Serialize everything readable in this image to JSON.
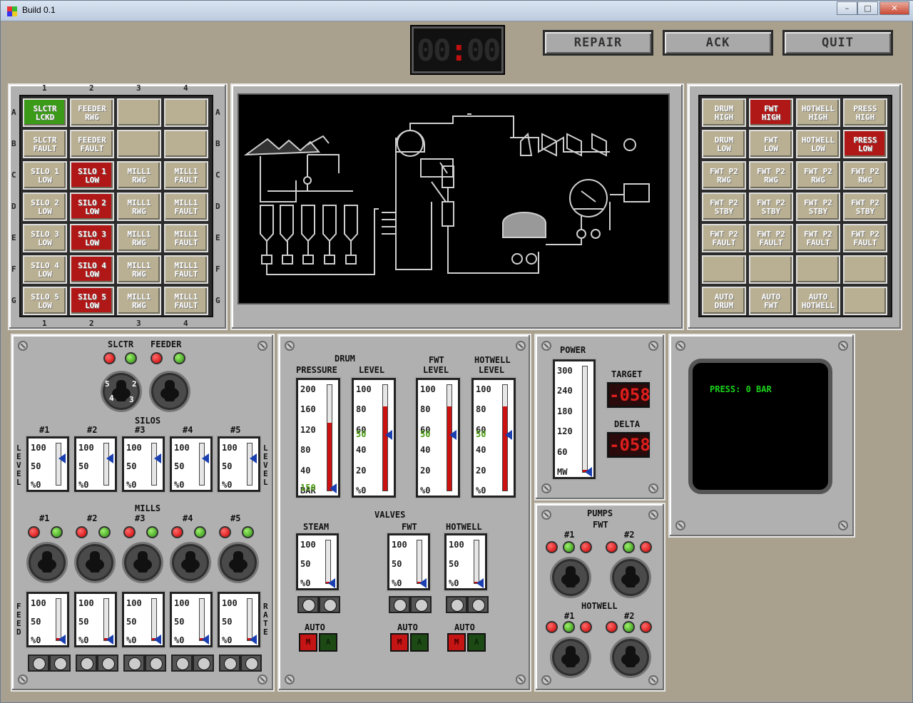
{
  "window": {
    "title": "Build 0.1",
    "minimize": "–",
    "maximize": "□",
    "close": "✕"
  },
  "toolbar": {
    "clock": [
      "00",
      ":",
      "00"
    ],
    "repair": "REPAIR",
    "ack": "ACK",
    "quit": "QUIT"
  },
  "annunciator_left": {
    "cols": [
      "1",
      "2",
      "3",
      "4"
    ],
    "rows": [
      "A",
      "B",
      "C",
      "D",
      "E",
      "F",
      "G"
    ],
    "cells": [
      [
        {
          "t": "SLCTR\nLCKD",
          "s": "green"
        },
        {
          "t": "FEEDER\nRWG",
          "s": "off"
        },
        {
          "t": "",
          "s": "off"
        },
        {
          "t": "",
          "s": "off"
        }
      ],
      [
        {
          "t": "SLCTR\nFAULT",
          "s": "off"
        },
        {
          "t": "FEEDER\nFAULT",
          "s": "off"
        },
        {
          "t": "",
          "s": "off"
        },
        {
          "t": "",
          "s": "off"
        }
      ],
      [
        {
          "t": "SILO 1\nLOW",
          "s": "off"
        },
        {
          "t": "SILO 1\nLOW",
          "s": "red"
        },
        {
          "t": "MILL1\nRWG",
          "s": "off"
        },
        {
          "t": "MILL1\nFAULT",
          "s": "off"
        }
      ],
      [
        {
          "t": "SILO 2\nLOW",
          "s": "off"
        },
        {
          "t": "SILO 2\nLOW",
          "s": "red"
        },
        {
          "t": "MILL1\nRWG",
          "s": "off"
        },
        {
          "t": "MILL1\nFAULT",
          "s": "off"
        }
      ],
      [
        {
          "t": "SILO 3\nLOW",
          "s": "off"
        },
        {
          "t": "SILO 3\nLOW",
          "s": "red"
        },
        {
          "t": "MILL1\nRWG",
          "s": "off"
        },
        {
          "t": "MILL1\nFAULT",
          "s": "off"
        }
      ],
      [
        {
          "t": "SILO 4\nLOW",
          "s": "off"
        },
        {
          "t": "SILO 4\nLOW",
          "s": "red"
        },
        {
          "t": "MILL1\nRWG",
          "s": "off"
        },
        {
          "t": "MILL1\nFAULT",
          "s": "off"
        }
      ],
      [
        {
          "t": "SILO 5\nLOW",
          "s": "off"
        },
        {
          "t": "SILO 5\nLOW",
          "s": "red"
        },
        {
          "t": "MILL1\nRWG",
          "s": "off"
        },
        {
          "t": "MILL1\nFAULT",
          "s": "off"
        }
      ]
    ]
  },
  "annunciator_right": {
    "cells": [
      [
        {
          "t": "DRUM\nHIGH",
          "s": "off"
        },
        {
          "t": "FWT\nHIGH",
          "s": "red"
        },
        {
          "t": "HOTWELL\nHIGH",
          "s": "off"
        },
        {
          "t": "PRESS\nHIGH",
          "s": "off"
        }
      ],
      [
        {
          "t": "DRUM\nLOW",
          "s": "off"
        },
        {
          "t": "FWT\nLOW",
          "s": "off"
        },
        {
          "t": "HOTWELL\nLOW",
          "s": "off"
        },
        {
          "t": "PRESS\nLOW",
          "s": "red"
        }
      ],
      [
        {
          "t": "FWT P2\nRWG",
          "s": "off"
        },
        {
          "t": "FWT P2\nRWG",
          "s": "off"
        },
        {
          "t": "FWT P2\nRWG",
          "s": "off"
        },
        {
          "t": "FWT P2\nRWG",
          "s": "off"
        }
      ],
      [
        {
          "t": "FWT P2\nSTBY",
          "s": "off"
        },
        {
          "t": "FWT P2\nSTBY",
          "s": "off"
        },
        {
          "t": "FWT P2\nSTBY",
          "s": "off"
        },
        {
          "t": "FWT P2\nSTBY",
          "s": "off"
        }
      ],
      [
        {
          "t": "FWT P2\nFAULT",
          "s": "off"
        },
        {
          "t": "FWT P2\nFAULT",
          "s": "off"
        },
        {
          "t": "FWT P2\nFAULT",
          "s": "off"
        },
        {
          "t": "FWT P2\nFAULT",
          "s": "off"
        }
      ],
      [
        {
          "t": "",
          "s": "off"
        },
        {
          "t": "",
          "s": "off"
        },
        {
          "t": "",
          "s": "off"
        },
        {
          "t": "",
          "s": "off"
        }
      ],
      [
        {
          "t": "AUTO\nDRUM",
          "s": "off"
        },
        {
          "t": "AUTO\nFWT",
          "s": "off"
        },
        {
          "t": "AUTO\nHOTWELL",
          "s": "off"
        },
        {
          "t": "",
          "s": "off"
        }
      ]
    ]
  },
  "fuel_panel": {
    "slctr": "SLCTR",
    "feeder": "FEEDER",
    "silos": "SILOS",
    "mills": "MILLS",
    "level": [
      "L",
      "E",
      "V",
      "E",
      "L"
    ],
    "feed": [
      "F",
      "E",
      "E",
      "D"
    ],
    "rate": [
      "R",
      "A",
      "T",
      "E"
    ],
    "nums": [
      "#1",
      "#2",
      "#3",
      "#4",
      "#5"
    ],
    "knob_marks": [
      "5",
      "2",
      "4",
      "3"
    ],
    "gauge_ticks": [
      "100",
      "50",
      "%0"
    ]
  },
  "water_panel": {
    "drum": "DRUM",
    "pressure": "PRESSURE",
    "level": "LEVEL",
    "fwt": "FWT",
    "fwt_level": "LEVEL",
    "hotwell": "HOTWELL",
    "hotwell_level": "LEVEL",
    "pressure_ticks": [
      "200",
      "160",
      "120",
      "80",
      "40",
      "BAR"
    ],
    "pressure_sp": "150",
    "level_ticks": [
      "100",
      "80",
      "60",
      "40",
      "20",
      "%0"
    ],
    "level_sp": "50",
    "valves": "VALVES",
    "steam": "STEAM",
    "auto": "AUTO",
    "manual_key": "M",
    "auto_key": "A",
    "valve_ticks": [
      "100",
      "50",
      "%0"
    ]
  },
  "power_panel": {
    "power": "POWER",
    "ticks": [
      "300",
      "240",
      "180",
      "120",
      "60",
      "MW"
    ],
    "target": "TARGET",
    "target_value": "-058",
    "delta": "DELTA",
    "delta_value": "-058"
  },
  "pumps_panel": {
    "pumps": "PUMPS",
    "fwt": "FWT",
    "hotwell": "HOTWELL",
    "p1": "#1",
    "p2": "#2"
  },
  "crt": {
    "text": "PRESS: 0 BAR"
  },
  "colors": {
    "alarm_red": "#b01818",
    "ok_green": "#3b9a18",
    "tile": "#b9b093",
    "panel": "#b0b0b0"
  }
}
